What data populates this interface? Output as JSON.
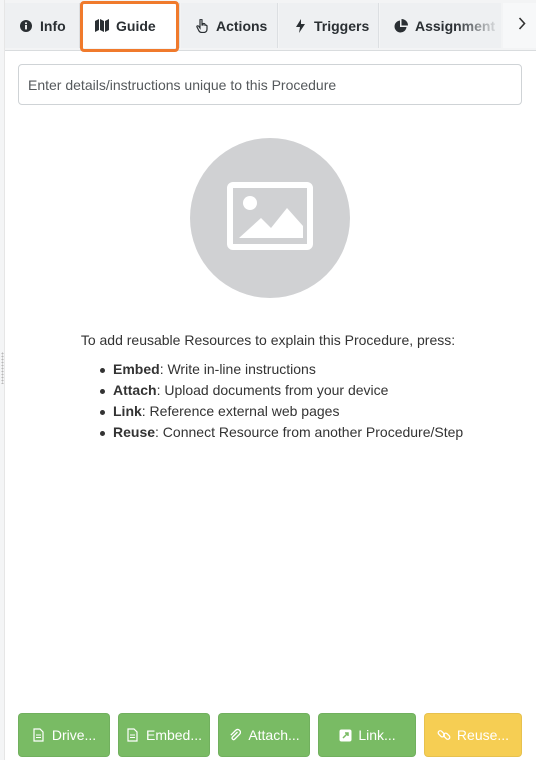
{
  "tabs": [
    {
      "label": "Info",
      "icon": "info-circle-icon",
      "active": false
    },
    {
      "label": "Guide",
      "icon": "map-icon",
      "active": true
    },
    {
      "label": "Actions",
      "icon": "pointer-hand-icon",
      "active": false
    },
    {
      "label": "Triggers",
      "icon": "lightning-bolt-icon",
      "active": false
    },
    {
      "label": "Assignment",
      "icon": "pie-chart-icon",
      "active": false
    }
  ],
  "tab_next_icon": "chevron-right-icon",
  "highlight_color": "#f07a2c",
  "description": {
    "placeholder": "Enter details/instructions unique to this Procedure",
    "value": ""
  },
  "empty_state": {
    "image_icon": "image-placeholder-icon",
    "prompt": "To add reusable Resources to explain this Procedure, press:",
    "items": [
      {
        "term": "Embed",
        "text": ": Write in-line instructions"
      },
      {
        "term": "Attach",
        "text": ": Upload documents from your device"
      },
      {
        "term": "Link",
        "text": ": Reference external web pages"
      },
      {
        "term": "Reuse",
        "text": ": Connect Resource from another Procedure/Step"
      }
    ]
  },
  "actions": [
    {
      "label": "Drive...",
      "icon": "document-icon",
      "color": "#79bb64"
    },
    {
      "label": "Embed...",
      "icon": "document-icon",
      "color": "#79bb64"
    },
    {
      "label": "Attach...",
      "icon": "paperclip-icon",
      "color": "#79bb64"
    },
    {
      "label": "Link...",
      "icon": "external-link-icon",
      "color": "#79bb64"
    },
    {
      "label": "Reuse...",
      "icon": "chain-link-icon",
      "color": "#f6ce53"
    }
  ]
}
